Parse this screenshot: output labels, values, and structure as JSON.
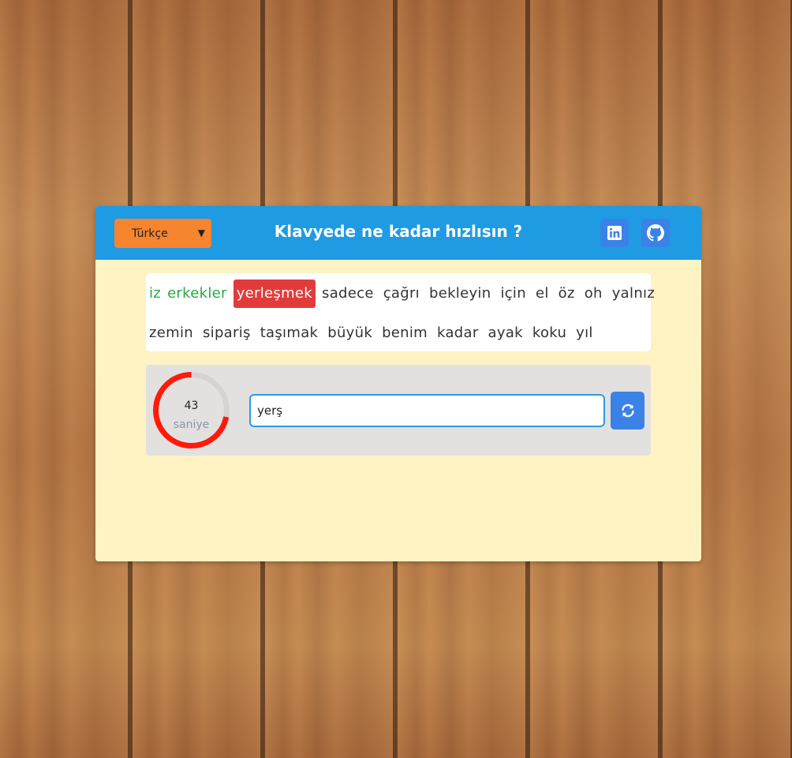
{
  "header": {
    "language": {
      "selected": "Türkçe"
    },
    "title": "Klavyede ne kadar hızlısın ?",
    "icons": {
      "linkedin": "linkedin-icon",
      "github": "github-icon"
    }
  },
  "words": {
    "lines": [
      [
        {
          "text": "iz",
          "state": "done"
        },
        {
          "text": "erkekler",
          "state": "done"
        },
        {
          "text": "yerleşmek",
          "state": "current"
        },
        {
          "text": "sadece",
          "state": "pending"
        },
        {
          "text": "çağrı",
          "state": "pending"
        },
        {
          "text": "bekleyin",
          "state": "pending"
        },
        {
          "text": "için",
          "state": "pending"
        },
        {
          "text": "el",
          "state": "pending"
        },
        {
          "text": "öz",
          "state": "pending"
        },
        {
          "text": "oh",
          "state": "pending"
        },
        {
          "text": "yalnız",
          "state": "pending"
        }
      ],
      [
        {
          "text": "zemin",
          "state": "pending"
        },
        {
          "text": "sipariş",
          "state": "pending"
        },
        {
          "text": "taşımak",
          "state": "pending"
        },
        {
          "text": "büyük",
          "state": "pending"
        },
        {
          "text": "benim",
          "state": "pending"
        },
        {
          "text": "kadar",
          "state": "pending"
        },
        {
          "text": "ayak",
          "state": "pending"
        },
        {
          "text": "koku",
          "state": "pending"
        },
        {
          "text": "yıl",
          "state": "pending"
        }
      ]
    ]
  },
  "timer": {
    "seconds": "43",
    "unit": "saniye",
    "remaining_fraction": 0.72
  },
  "input": {
    "value": "yerş"
  },
  "refresh": {
    "icon": "refresh-icon"
  },
  "colors": {
    "header": "#1f9be3",
    "card": "#fff2c3",
    "select": "#f7842f",
    "done_word": "#27a844",
    "current_word": "#e23b3b",
    "timer_ring": "#ff1a0a",
    "button": "#3b82e6"
  }
}
